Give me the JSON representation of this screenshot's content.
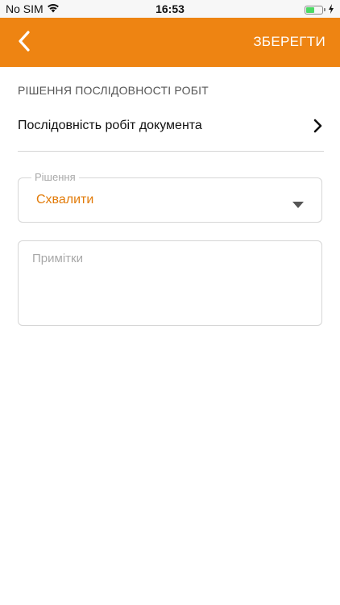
{
  "status_bar": {
    "carrier": "No SIM",
    "time": "16:53",
    "battery_level": 0.55,
    "battery_color": "#4cd964"
  },
  "nav_bar": {
    "background": "#ee8412",
    "back_icon": "chevron-left-icon",
    "save_label": "ЗБЕРЕГТИ"
  },
  "section": {
    "header": "РІШЕННЯ ПОСЛІДОВНОСТІ РОБІТ"
  },
  "workflow": {
    "label": "Послідовність робіт документа",
    "icon": "chevron-right-icon"
  },
  "decision": {
    "label": "Рішення",
    "value": "Схвалити",
    "value_color": "#e27b09",
    "icon": "caret-down-icon"
  },
  "notes": {
    "placeholder": "Примітки",
    "value": ""
  }
}
